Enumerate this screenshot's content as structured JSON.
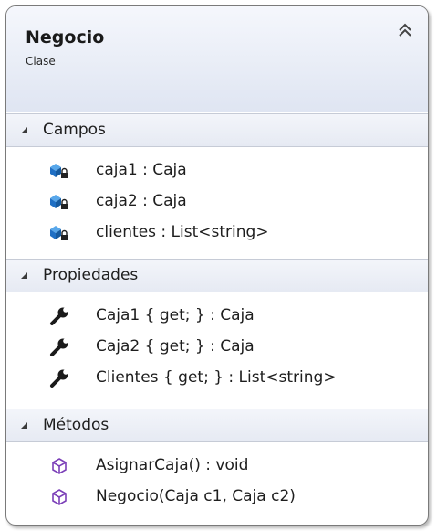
{
  "class_box": {
    "name": "Negocio",
    "kind": "Clase",
    "collapse_icon": "double-chevron-up-icon"
  },
  "sections": {
    "fields": {
      "label": "Campos",
      "expander_icon": "expanded-triangle-icon",
      "items": [
        {
          "text": "caja1 : Caja",
          "icon": "private-field-icon"
        },
        {
          "text": "caja2 : Caja",
          "icon": "private-field-icon"
        },
        {
          "text": "clientes : List<string>",
          "icon": "private-field-icon"
        }
      ]
    },
    "properties": {
      "label": "Propiedades",
      "expander_icon": "expanded-triangle-icon",
      "items": [
        {
          "text": "Caja1 { get; } : Caja",
          "icon": "wrench-property-icon"
        },
        {
          "text": "Caja2 { get; } : Caja",
          "icon": "wrench-property-icon"
        },
        {
          "text": "Clientes { get; } : List<string>",
          "icon": "wrench-property-icon"
        }
      ]
    },
    "methods": {
      "label": "Métodos",
      "expander_icon": "expanded-triangle-icon",
      "items": [
        {
          "text": "AsignarCaja() : void",
          "icon": "method-cube-icon"
        },
        {
          "text": "Negocio(Caja c1, Caja c2)",
          "icon": "method-cube-icon"
        }
      ]
    }
  },
  "colors": {
    "field_icon": "#1f6fc4",
    "method_icon": "#7b3fb8",
    "wrench": "#1a1a1a"
  }
}
